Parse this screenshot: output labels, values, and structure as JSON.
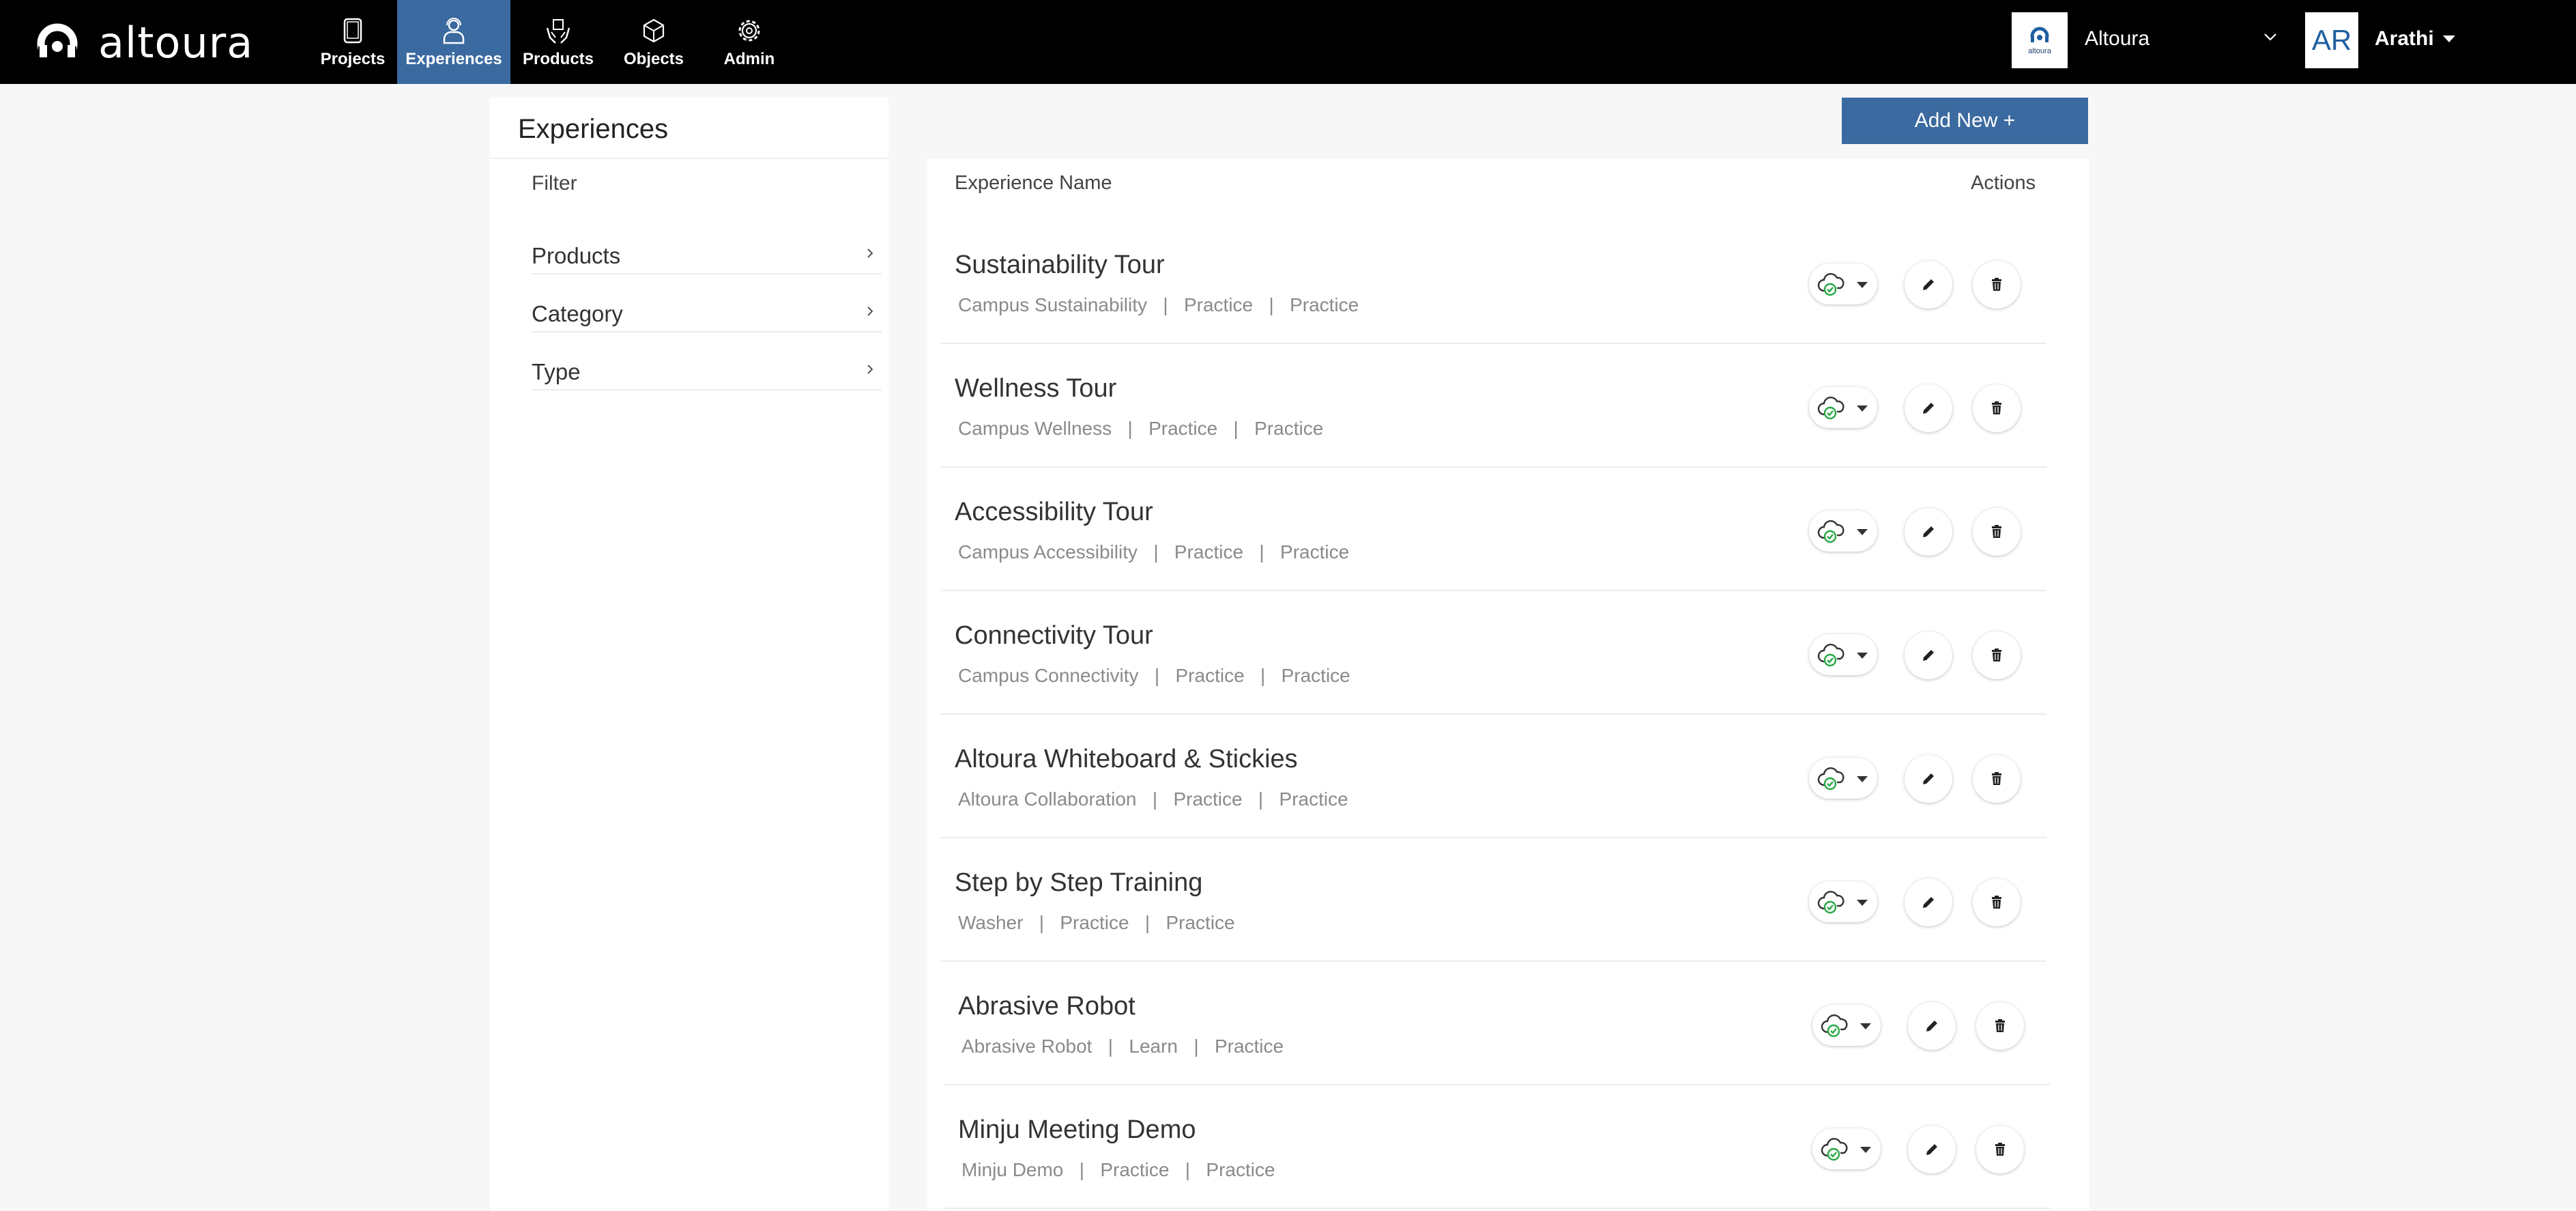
{
  "brand": {
    "name": "altoura"
  },
  "nav": [
    {
      "label": "Projects",
      "icon": "tablet-icon",
      "active": false
    },
    {
      "label": "Experiences",
      "icon": "user-headset-icon",
      "active": true
    },
    {
      "label": "Products",
      "icon": "hands-box-icon",
      "active": false
    },
    {
      "label": "Objects",
      "icon": "cube-icon",
      "active": false
    },
    {
      "label": "Admin",
      "icon": "gear-icon",
      "active": false
    }
  ],
  "org": {
    "logo_text": "altoura",
    "name": "Altoura"
  },
  "user": {
    "initials": "AR",
    "name": "Arathi"
  },
  "page": {
    "title": "Experiences",
    "add_button": "Add New +"
  },
  "filter": {
    "label": "Filter",
    "items": [
      {
        "label": "Products"
      },
      {
        "label": "Category"
      },
      {
        "label": "Type"
      }
    ]
  },
  "table": {
    "headers": {
      "name": "Experience Name",
      "actions": "Actions"
    },
    "rows": [
      {
        "name": "Sustainability Tour",
        "meta": "Campus Sustainability   |   Practice   |   Practice"
      },
      {
        "name": "Wellness Tour",
        "meta": "Campus Wellness   |   Practice   |   Practice"
      },
      {
        "name": "Accessibility Tour",
        "meta": "Campus Accessibility   |   Practice   |   Practice"
      },
      {
        "name": "Connectivity Tour",
        "meta": "Campus Connectivity   |   Practice   |   Practice"
      },
      {
        "name": "Altoura Whiteboard & Stickies",
        "meta": "Altoura Collaboration   |   Practice   |   Practice"
      },
      {
        "name": "Step by Step Training",
        "meta": "Washer   |   Practice   |   Practice"
      },
      {
        "name": "Abrasive Robot",
        "meta": "Abrasive Robot   |   Learn   |   Practice"
      },
      {
        "name": "Minju Meeting Demo",
        "meta": "Minju Demo   |   Practice   |   Practice"
      }
    ]
  },
  "colors": {
    "accent": "#3b6aa0",
    "topbar": "#000000",
    "publish_green": "#27a844"
  }
}
